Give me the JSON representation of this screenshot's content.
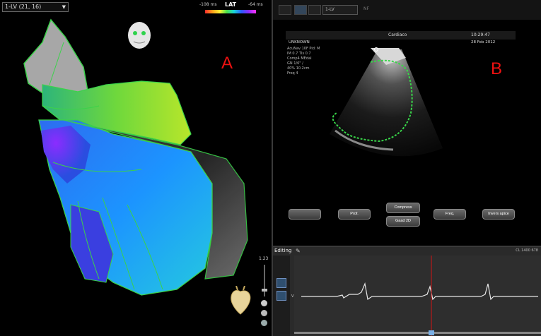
{
  "left_panel": {
    "map_selector": "1-LV (21, 16)",
    "lat": {
      "title": "LAT",
      "min": "-108 ms",
      "max": "-64 ms"
    },
    "label": "A"
  },
  "right_panel": {
    "toolbar": {
      "preset": "1-LV",
      "extra": "NF"
    },
    "ultrasound": {
      "preset": "Cardiaco",
      "patient": "UNKNOWN",
      "time": "10:29:47",
      "date": "28 Feb 2012",
      "info_lines": [
        "AcuNav 10F Pid: M",
        "IM 0.7 TIs 0.7",
        "Comp4 MEdal",
        "GN 1/6\" /",
        "40% 10.2cm",
        "Freq 4"
      ]
    },
    "label": "B",
    "buttons": [
      "",
      "Prof.",
      "Compress",
      "Gaad 2D",
      "Freq.",
      "Invers apice"
    ]
  },
  "bottom_panel": {
    "title": "Editing",
    "scale_value": "1.23",
    "channel": "V1",
    "top_right": "CL  1400  678"
  },
  "colors": {
    "lat_accent": "#ffffff",
    "contour": "#39d64a",
    "marker_line": "#d21414"
  },
  "icons": [
    "chevron-down-icon",
    "face-orientation-icon",
    "heart-orientation-icon",
    "pencil-icon"
  ]
}
